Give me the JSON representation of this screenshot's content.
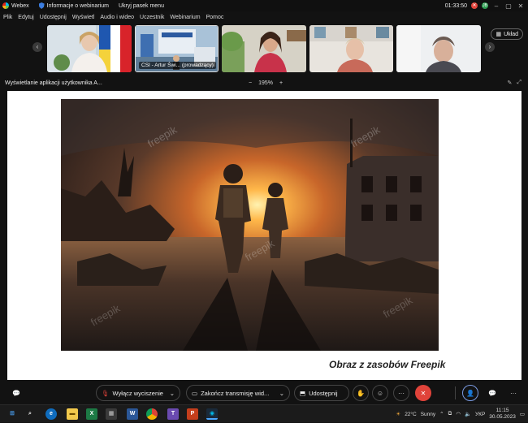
{
  "titlebar": {
    "app_name": "Webex",
    "webinar_info": "Informacje o webinarium",
    "hide_menu": "Ukryj pasek menu",
    "timer": "01:33:50",
    "avatar_initials": "JB"
  },
  "menu": {
    "items": [
      "Plik",
      "Edytuj",
      "Udostępnij",
      "Wyświetl",
      "Audio i wideo",
      "Uczestnik",
      "Webinarium",
      "Pomoc"
    ]
  },
  "video_strip": {
    "presenter_label": "CSI - Artur Świ... (prowadzący)",
    "layout_label": "Układ"
  },
  "share_bar": {
    "title": "Wyświetlanie aplikacji użytkownika A...",
    "zoom_minus": "−",
    "zoom_level": "195%",
    "zoom_plus": "+"
  },
  "shared_content": {
    "caption": "Obraz z zasobów Freepik",
    "watermark": "freepik"
  },
  "controls": {
    "mute_label": "Wyłącz wyciszenie",
    "stop_video_label": "Zakończ transmisję wid...",
    "share_label": "Udostępnij",
    "more_label": "···",
    "end_label": "✕",
    "chat_label": "···"
  },
  "taskbar": {
    "weather_temp": "22°C",
    "weather_desc": "Sunny",
    "language": "УКР",
    "time": "11:15",
    "date": "30.05.2023"
  },
  "colors": {
    "accent_red": "#e0433a",
    "background": "#121212",
    "shared_bg": "#ffffff"
  }
}
